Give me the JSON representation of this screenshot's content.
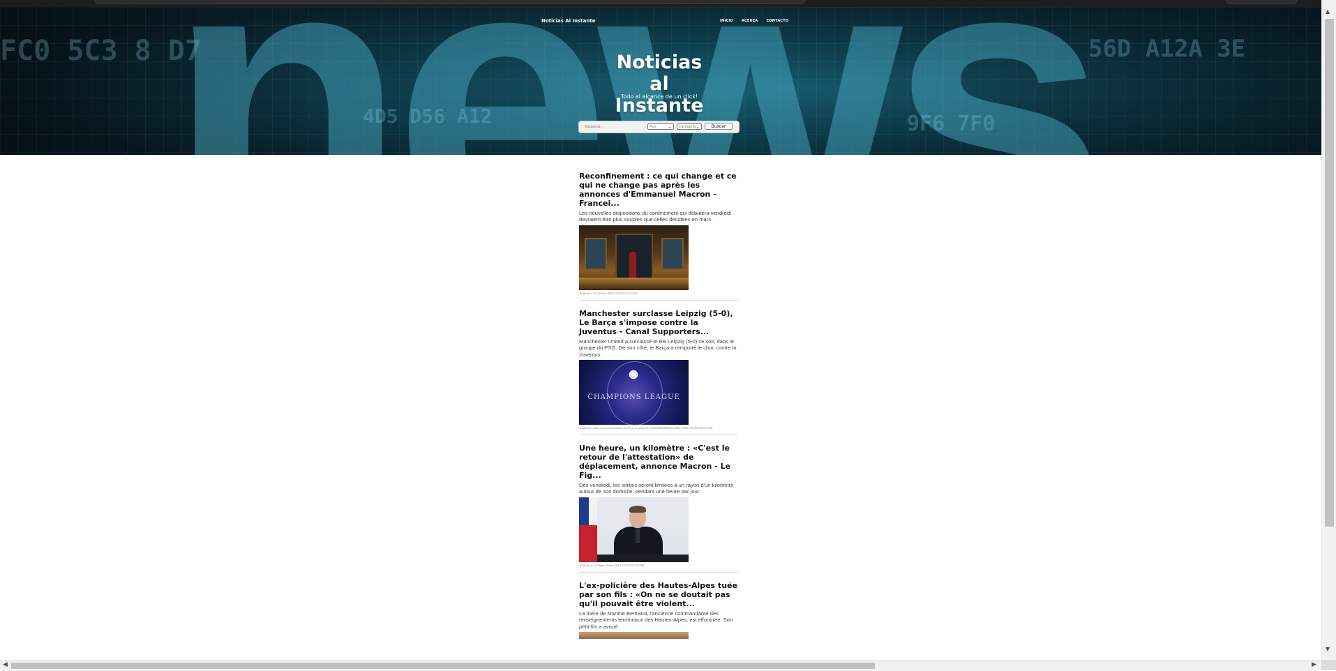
{
  "navbar": {
    "brand": "Noticias Al Instante",
    "links": [
      "INICIO",
      "ACERCA",
      "CONTACTO"
    ]
  },
  "hero": {
    "title": "Noticias al Instante",
    "subtitle": "Todo al alcance de un click!",
    "search_placeholder": "Búsqueda . . .",
    "select_country": "País",
    "select_category": "Categoría",
    "search_button": "Buscar",
    "background_word": "news"
  },
  "articles": [
    {
      "title": "Reconfinement : ce qui change et ce qui ne change pas après les annonces d'Emmanuel Macron - Francei...",
      "description": "Les nouvelles dispositions du confinement qui débutera vendredi devraient être plus souples que celles décidées en mars.",
      "meta": "Author(s): N/A Date: 2020-10-28T22:30:40Z"
    },
    {
      "title": "Manchester surclasse Leipzig (5-0), Le Barça s'impose contre la Juventus - Canal Supporters...",
      "description": "Manchester United a surclassé le RB Leipzig (5-0) ce soir, dans le groupe du PSG. De son côté, le Barça a remporté le choc contre la Juventus.",
      "meta": "Author(s): https://www.facebook.com/?/projet.php?id=100009843869055 Date: 2020-10-28T20:50:50Z"
    },
    {
      "title": "Une heure, un kilomètre : «C'est le retour de l'attestation» de déplacement, annonce Macron - Le Fig...",
      "description": "Dès vendredi, les sorties seront limitées à un rayon d'un kilomètre autour de son domicile, pendant une heure par jour.",
      "meta": "Author(s): Le Figaro Date: 2020-10-28T19:54:00Z"
    },
    {
      "title": "L'ex-policière des Hautes-Alpes tuée par son fils : «On ne se doutait pas qu'il pouvait être violent...",
      "description": "La mère de Martine Bertrand, l'ancienne commandante des renseignements territoriaux des Hautes-Alpes, est effondrée. Son petit-fils a avoué",
      "meta": ""
    }
  ],
  "image_labels": {
    "champions_league": "CHAMPIONS LEAGUE"
  },
  "colors": {
    "hero_accent": "#4fb5cf",
    "header_bg": "#0c3b4a",
    "text_dark": "#111111"
  }
}
